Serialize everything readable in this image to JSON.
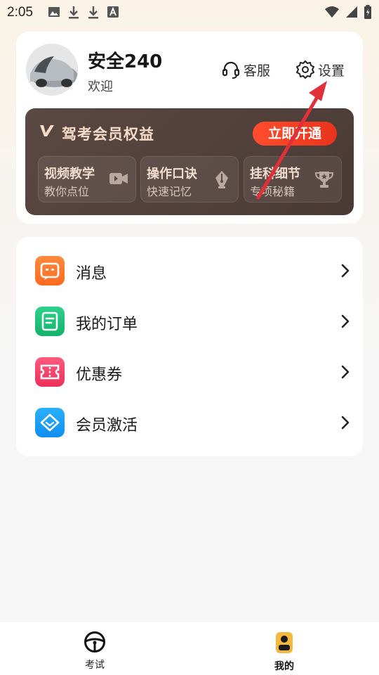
{
  "status_bar": {
    "time": "2:05",
    "icons": [
      "image-icon",
      "download-icon",
      "download-icon",
      "font-icon"
    ],
    "right_icons": [
      "wifi-icon",
      "signal-icon",
      "battery-icon"
    ]
  },
  "profile": {
    "username": "安全240",
    "welcome": "欢迎",
    "customer_service_label": "客服",
    "settings_label": "设置"
  },
  "vip": {
    "title": "驾考会员权益",
    "open_button": "立即开通",
    "benefits": [
      {
        "title": "视频教学",
        "subtitle": "教你点位",
        "icon": "video-icon"
      },
      {
        "title": "操作口诀",
        "subtitle": "快速记忆",
        "icon": "pen-icon"
      },
      {
        "title": "挂科细节",
        "subtitle": "专项秘籍",
        "icon": "trophy-icon"
      }
    ]
  },
  "menu": {
    "items": [
      {
        "label": "消息",
        "icon": "message-icon",
        "color": "#ff7a2e"
      },
      {
        "label": "我的订单",
        "icon": "order-icon",
        "color": "#1fbf7a"
      },
      {
        "label": "优惠券",
        "icon": "coupon-icon",
        "color": "#f2436b"
      },
      {
        "label": "会员激活",
        "icon": "diamond-icon",
        "color": "#1e9bf0"
      }
    ]
  },
  "tabbar": {
    "tabs": [
      {
        "label": "考试",
        "icon": "steering-wheel-icon",
        "active": false
      },
      {
        "label": "我的",
        "icon": "profile-icon",
        "active": true
      }
    ]
  },
  "colors": {
    "accent_red": "#e8341c",
    "banner_brown": "#4f3e38",
    "annotation_arrow": "#e0303a"
  }
}
